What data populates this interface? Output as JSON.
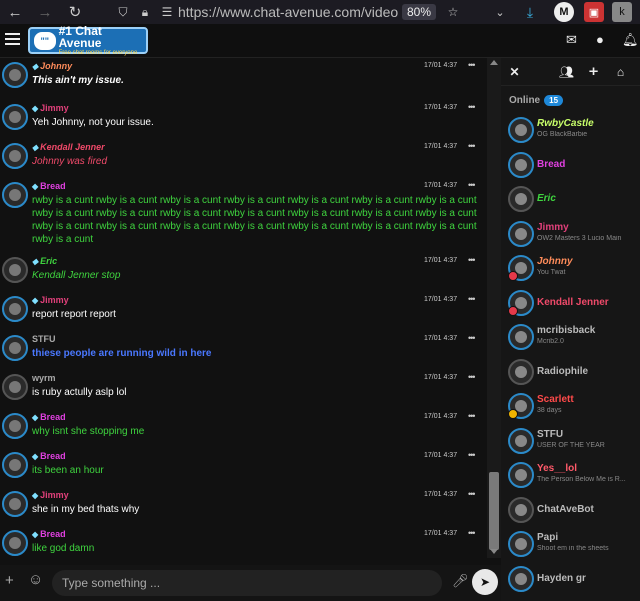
{
  "browser": {
    "url": "https://www.chat-avenue.com/videoga",
    "zoom": "80%",
    "icons": [
      "back-arrow-icon",
      "forward-arrow-icon",
      "reload-icon",
      "shield-icon",
      "lock-icon",
      "permissions-icon",
      "star-icon"
    ]
  },
  "logo": {
    "title": "#1 Chat Avenue",
    "subtitle": "Free chat rooms for everyone",
    "bubble": "\"\"",
    "accent": "#1c6fb5"
  },
  "messages": [
    {
      "user": "Johnny",
      "time": "17/01 4:37",
      "text": "This ain't my issue.",
      "name_color": "#ff8c5a",
      "text_color": "#ffffff",
      "style": "italic-bold"
    },
    {
      "user": "Jimmy",
      "time": "17/01 4:37",
      "text": "Yeh Johnny, not your issue.",
      "name_color": "#e0407a",
      "text_color": "#ffffff",
      "style": "normal"
    },
    {
      "user": "Kendall Jenner",
      "time": "17/01 4:37",
      "text": "Johnny was fired",
      "name_color": "#f04a6a",
      "text_color": "#f04a6a",
      "style": "italic"
    },
    {
      "user": "Bread",
      "time": "17/01 4:37",
      "text": "rwby is a cunt rwby is a cunt rwby is a cunt rwby is a cunt rwby is a cunt rwby is a cunt rwby is a cunt rwby is a cunt rwby is a cunt rwby is a cunt rwby is a cunt rwby is a cunt rwby is a cunt rwby is a cunt rwby is a cunt rwby is a cunt rwby is a cunt rwby is a cunt rwby is a cunt rwby is a cunt rwby is a cunt rwby is a cunt",
      "name_color": "#e040e0",
      "text_color": "#3fd43f",
      "style": "normal"
    },
    {
      "user": "Eric",
      "time": "17/01 4:37",
      "text": "Kendall Jenner stop",
      "name_color": "#3fd43f",
      "text_color": "#3fd43f",
      "style": "italic"
    },
    {
      "user": "Jimmy",
      "time": "17/01 4:37",
      "text": "report report report",
      "name_color": "#e0407a",
      "text_color": "#ffffff",
      "style": "normal"
    },
    {
      "user": "STFU",
      "time": "17/01 4:37",
      "text": "thiese people are running wild in here",
      "name_color": "#aaaaaa",
      "text_color": "#4a78ff",
      "style": "bold"
    },
    {
      "user": "wyrm",
      "time": "17/01 4:37",
      "text": "is ruby actully aslp lol",
      "name_color": "#aaaaaa",
      "text_color": "#ffffff",
      "style": "normal"
    },
    {
      "user": "Bread",
      "time": "17/01 4:37",
      "text": "why isnt she stopping me",
      "name_color": "#e040e0",
      "text_color": "#3fd43f",
      "style": "normal"
    },
    {
      "user": "Bread",
      "time": "17/01 4:37",
      "text": "its been an hour",
      "name_color": "#e040e0",
      "text_color": "#3fd43f",
      "style": "normal"
    },
    {
      "user": "Jimmy",
      "time": "17/01 4:37",
      "text": "she in my bed thats why",
      "name_color": "#e0407a",
      "text_color": "#ffffff",
      "style": "normal"
    },
    {
      "user": "Bread",
      "time": "17/01 4:37",
      "text": "like god damn",
      "name_color": "#e040e0",
      "text_color": "#3fd43f",
      "style": "normal"
    }
  ],
  "sidebar": {
    "online_label": "Online",
    "online_count": "15",
    "users": [
      {
        "name": "RwbyCastle",
        "status": "OG BlackBarbie",
        "color": "#c8ff6a",
        "badge": "none"
      },
      {
        "name": "Bread",
        "status": "",
        "color": "#e040e0",
        "badge": "none"
      },
      {
        "name": "Eric",
        "status": "",
        "color": "#3fd43f",
        "badge": "none"
      },
      {
        "name": "Jimmy",
        "status": "OW2 Masters 3 Lucio Main",
        "color": "#e0407a",
        "badge": "none"
      },
      {
        "name": "Johnny",
        "status": "You Twat",
        "color": "#ff8c5a",
        "badge": "red"
      },
      {
        "name": "Kendall Jenner",
        "status": "",
        "color": "#f04a6a",
        "badge": "red"
      },
      {
        "name": "mcribisback",
        "status": "Mcrib2.0",
        "color": "#bbbbbb",
        "badge": "none"
      },
      {
        "name": "Radiophile",
        "status": "",
        "color": "#bbbbbb",
        "badge": "none"
      },
      {
        "name": "Scarlett",
        "status": "38 days",
        "color": "#ff4a4a",
        "badge": "yellow"
      },
      {
        "name": "STFU",
        "status": "USER OF THE YEAR",
        "color": "#bbbbbb",
        "badge": "none"
      },
      {
        "name": "Yes__lol",
        "status": "The Person Below Me is R...",
        "color": "#ff5a6a",
        "badge": "none"
      },
      {
        "name": "ChatAveBot",
        "status": "",
        "color": "#bbbbbb",
        "badge": "none"
      },
      {
        "name": "Papi",
        "status": "Shoot em in the sheets",
        "color": "#bbbbbb",
        "badge": "none"
      },
      {
        "name": "Hayden gr",
        "status": "",
        "color": "#bbbbbb",
        "badge": "none"
      }
    ]
  },
  "input": {
    "placeholder": "Type something ..."
  }
}
